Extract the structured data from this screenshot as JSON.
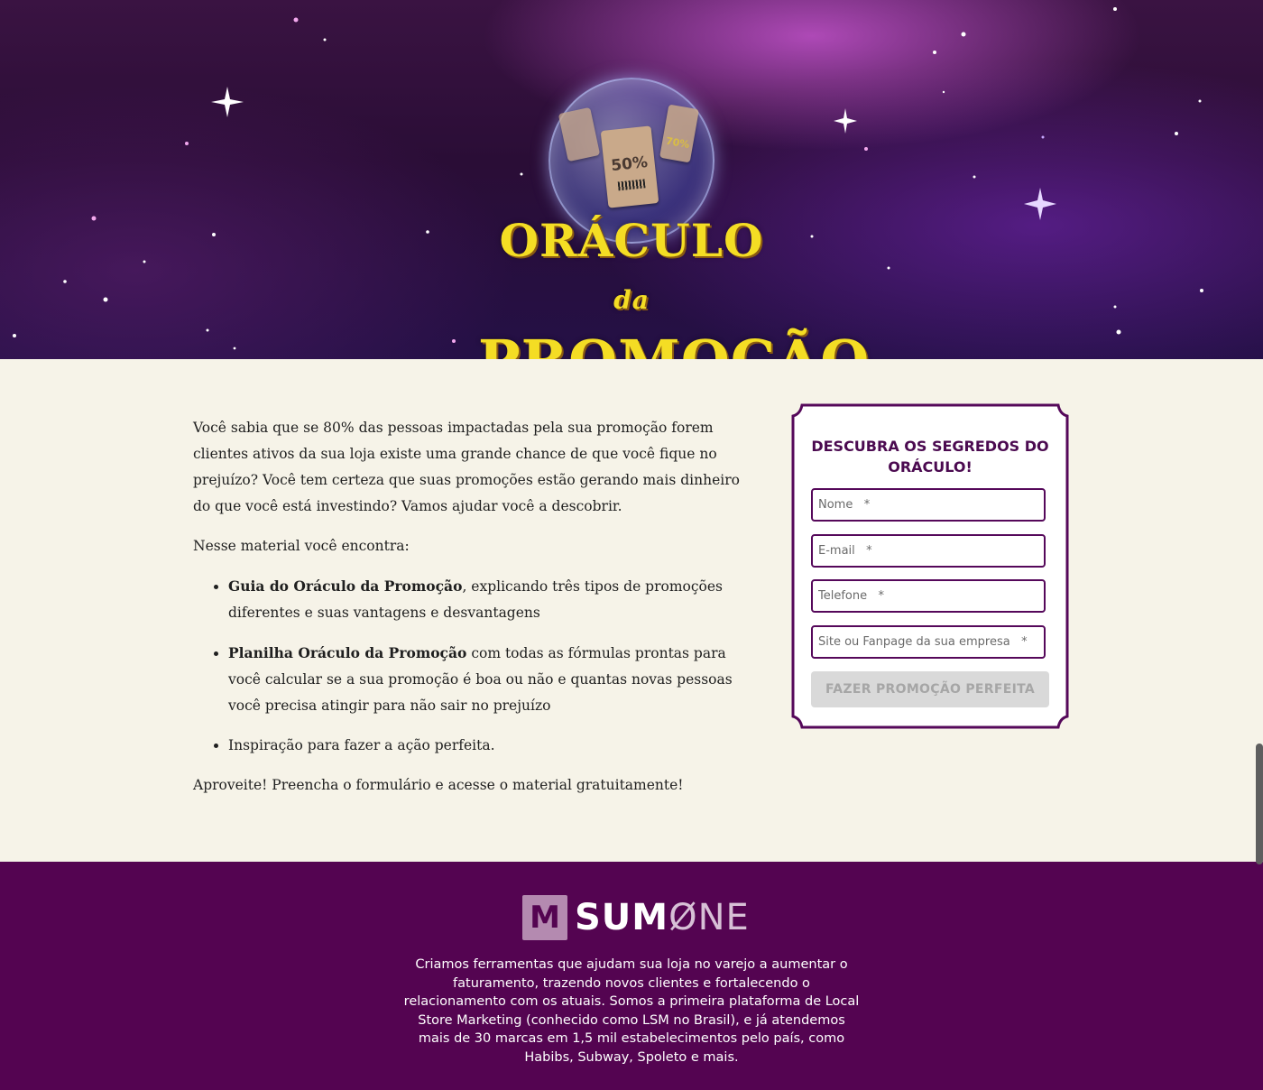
{
  "hero": {
    "title_line1": "ORÁCULO",
    "title_da": "da",
    "title_line2": "PROMOÇÃO",
    "tag_main_pct": "50%",
    "tag_right_pct": "70%"
  },
  "intro": {
    "paragraph": "Você sabia que se 80% das pessoas impactadas pela sua promoção forem clientes ativos da sua loja existe uma grande chance de que você fique no prejuízo? Você tem certeza que suas promoções estão gerando mais dinheiro do que você está investindo? Vamos ajudar você a descobrir.",
    "lead": "Nesse material você encontra:",
    "items": [
      {
        "bold": "Guia do Oráculo da Promoção",
        "text": ", explicando três tipos de promoções diferentes e suas vantagens e desvantagens"
      },
      {
        "bold": "Planilha Oráculo da Promoção",
        "text": " com todas as fórmulas prontas para você calcular se a sua promoção é boa ou não e quantas novas pessoas você precisa atingir para não sair no prejuízo"
      },
      {
        "bold": "",
        "text": "Inspiração para fazer a ação perfeita."
      }
    ],
    "closing": "Aproveite! Preencha o formulário e acesse o material gratuitamente!"
  },
  "form": {
    "title": "DESCUBRA OS SEGREDOS DO ORÁCULO!",
    "name_placeholder": "Nome   *",
    "email_placeholder": "E-mail   *",
    "phone_placeholder": "Telefone   *",
    "site_placeholder": "Site ou Fanpage da sua empresa   *",
    "submit_label": "FAZER PROMOÇÃO PERFEITA"
  },
  "footer": {
    "logo_mark": "M",
    "logo_sum": "SUM",
    "logo_one": "ØNE",
    "description": "Criamos ferramentas que ajudam sua loja no varejo a aumentar o faturamento, trazendo novos clientes e fortalecendo o relacionamento com os atuais. Somos a primeira plataforma de Local Store Marketing (conhecido como LSM no Brasil), e já atendemos mais de 30 marcas em 1,5 mil estabelecimentos pelo país, como Habibs, Subway, Spoleto e mais."
  },
  "colors": {
    "accent_purple": "#540451",
    "title_yellow": "#f4dd24",
    "background_cream": "#f6f3e8"
  }
}
